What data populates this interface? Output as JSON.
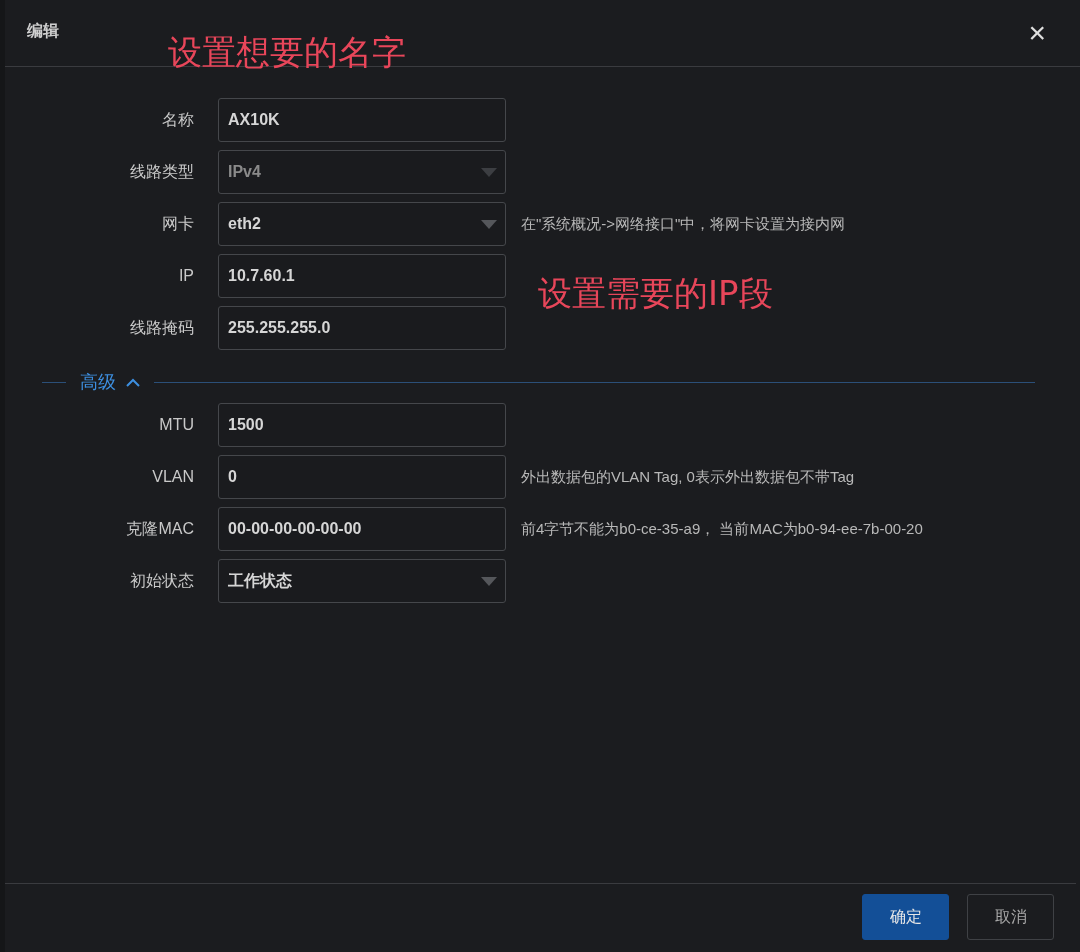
{
  "dialog": {
    "title": "编辑",
    "close": "×"
  },
  "annotations": [
    {
      "text": "设置想要的名字"
    },
    {
      "text": "设置需要的IP段"
    }
  ],
  "fields": [
    {
      "label": "名称",
      "kind": "input",
      "value": "AX10K",
      "disabled": false
    },
    {
      "label": "线路类型",
      "kind": "select",
      "value": "IPv4",
      "disabled": true
    },
    {
      "label": "网卡",
      "kind": "select",
      "value": "eth2",
      "disabled": false,
      "hint": "在\"系统概况->网络接口\"中，将网卡设置为接内网"
    },
    {
      "label": "IP",
      "kind": "input",
      "value": "10.7.60.1",
      "disabled": false
    },
    {
      "label": "线路掩码",
      "kind": "input",
      "value": "255.255.255.0",
      "disabled": false
    }
  ],
  "advanced": {
    "label": "高级",
    "expanded": true,
    "fields": [
      {
        "label": "MTU",
        "kind": "input",
        "value": "1500",
        "disabled": false
      },
      {
        "label": "VLAN",
        "kind": "input",
        "value": "0",
        "disabled": false,
        "hint": "外出数据包的VLAN Tag, 0表示外出数据包不带Tag"
      },
      {
        "label": "克隆MAC",
        "kind": "input",
        "value": "00-00-00-00-00-00",
        "disabled": false,
        "hint": "前4字节不能为b0-ce-35-a9， 当前MAC为b0-94-ee-7b-00-20"
      },
      {
        "label": "初始状态",
        "kind": "select",
        "value": "工作状态",
        "disabled": false
      }
    ]
  },
  "buttons": [
    {
      "label": "确定",
      "kind": "primary"
    },
    {
      "label": "取消",
      "kind": "secondary"
    }
  ]
}
